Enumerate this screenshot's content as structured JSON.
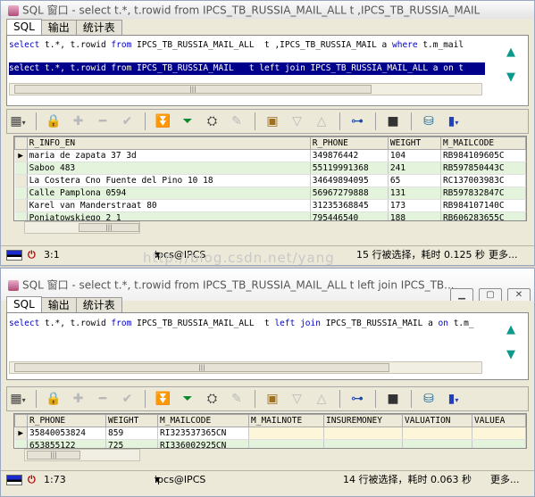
{
  "window1": {
    "title": "SQL 窗口 - select t.*, t.rowid from IPCS_TB_RUSSIA_MAIL_ALL t ,IPCS_TB_RUSSIA_MAIL",
    "tabs": [
      "SQL",
      "输出",
      "统计表"
    ],
    "sql_line1": "select t.*, t.rowid from IPCS_TB_RUSSIA_MAIL_ALL  t ,IPCS_TB_RUSSIA_MAIL a where t.m_mail",
    "sql_line2": "select t.*, t.rowid from IPCS_TB_RUSSIA_MAIL   t left join IPCS_TB_RUSSIA_MAIL_ALL a on t",
    "columns": [
      "R_INFO_EN",
      "R_PHONE",
      "WEIGHT",
      "M_MAILCODE"
    ],
    "rows": [
      [
        "maria de zapata 37 3d",
        "349876442",
        "104",
        "RB984109605C"
      ],
      [
        "Saboo 483",
        "55119991368",
        "241",
        "RB597850443C"
      ],
      [
        "La Costera  Cno Fuente del Pino 10 18",
        "34649894095",
        "65",
        "RC137003983C"
      ],
      [
        "Calle Pamplona  0594",
        "56967279888",
        "131",
        "RB597832847C"
      ],
      [
        "Karel van Manderstraat 80",
        "31235368845",
        "173",
        "RB984107140C"
      ],
      [
        "Poniatowskiego 2 1",
        "795446540",
        "188",
        "RB606283655C"
      ]
    ],
    "status": {
      "cursor": "3:1",
      "connection": "ipcs@IPCS",
      "message": "15 行被选择，耗时 0.125 秒",
      "more": "更多..."
    }
  },
  "window2": {
    "title": "SQL 窗口 - select t.*, t.rowid from IPCS_TB_RUSSIA_MAIL_ALL t left join IPCS_TB...",
    "tabs": [
      "SQL",
      "输出",
      "统计表"
    ],
    "sql_line1": "select t.*, t.rowid from IPCS_TB_RUSSIA_MAIL_ALL  t left join IPCS_TB_RUSSIA_MAIL a on t.m_",
    "columns": [
      "R_PHONE",
      "WEIGHT",
      "M_MAILCODE",
      "M_MAILNOTE",
      "INSUREMONEY",
      "VALUATION",
      "VALUEA"
    ],
    "rows": [
      [
        "35840053824",
        "859",
        "RI323537365CN",
        "",
        "",
        "",
        ""
      ],
      [
        "653855122",
        "725",
        "RI336002925CN",
        "",
        "",
        "",
        ""
      ]
    ],
    "status": {
      "cursor": "1:73",
      "connection": "ipcs@IPCS",
      "message": "14 行被选择，耗时 0.063 秒",
      "more": "更多..."
    }
  },
  "watermark": "http://blog.csdn.net/yang",
  "icons": [
    "grid-icon",
    "lock-icon",
    "plus-icon",
    "minus-icon",
    "check-icon",
    "fetch-next-icon",
    "fetch-all-icon",
    "binoculars-icon",
    "eraser-icon",
    "export-icon",
    "filter-down-icon",
    "filter-up-icon",
    "tree-icon",
    "save-icon",
    "database-icon",
    "chart-icon",
    "up-arrow-icon",
    "down-arrow-icon"
  ]
}
